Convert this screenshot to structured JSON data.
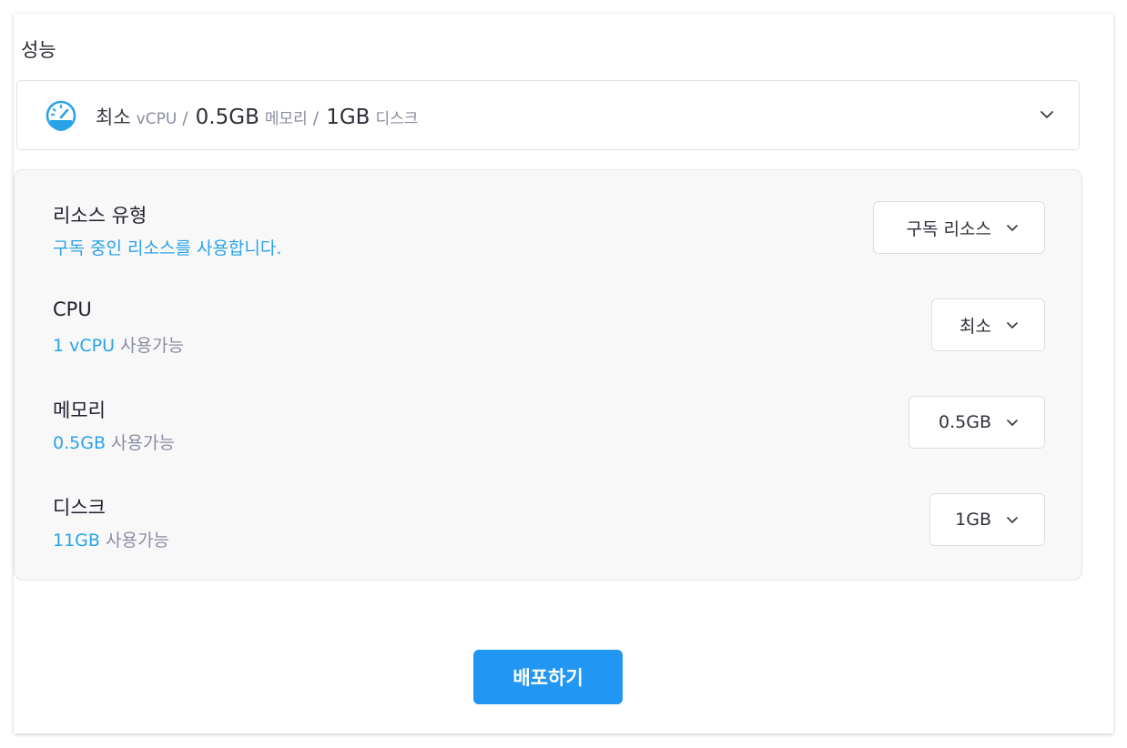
{
  "section": {
    "title": "성능"
  },
  "summary": {
    "icon": "speedometer-icon",
    "tier": "최소",
    "cpu_unit": "vCPU",
    "sep": "/",
    "memory_value": "0.5GB",
    "memory_label": "메모리",
    "disk_value": "1GB",
    "disk_label": "디스크",
    "chevron": "chevron-down-icon"
  },
  "rows": [
    {
      "label": "리소스 유형",
      "desc_value": "구독 중인 리소스를 사용합니다.",
      "desc_suffix": "",
      "select_value": "구독 리소스"
    },
    {
      "label": "CPU",
      "desc_value": "1 vCPU",
      "desc_suffix": "사용가능",
      "select_value": "최소"
    },
    {
      "label": "메모리",
      "desc_value": "0.5GB",
      "desc_suffix": "사용가능",
      "select_value": "0.5GB"
    },
    {
      "label": "디스크",
      "desc_value": "11GB",
      "desc_suffix": "사용가능",
      "select_value": "1GB"
    }
  ],
  "deploy": {
    "label": "배포하기"
  },
  "colors": {
    "accent": "#2196f3",
    "link_blue": "#29a3e8",
    "muted": "#8a8da3",
    "panel_bg": "#f8f8f9"
  }
}
